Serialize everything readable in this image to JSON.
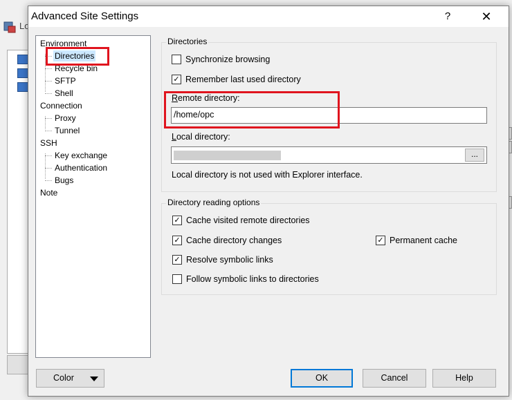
{
  "background_app": {
    "title_fragment": "Lo"
  },
  "dialog": {
    "title": "Advanced Site Settings",
    "help_glyph": "?",
    "close_glyph": "✕"
  },
  "tree": {
    "groups": [
      {
        "label": "Environment",
        "children": [
          "Directories",
          "Recycle bin",
          "SFTP",
          "Shell"
        ]
      },
      {
        "label": "Connection",
        "children": [
          "Proxy",
          "Tunnel"
        ]
      },
      {
        "label": "SSH",
        "children": [
          "Key exchange",
          "Authentication",
          "Bugs"
        ]
      },
      {
        "label": "Note",
        "children": []
      }
    ],
    "selected": "Directories"
  },
  "directories": {
    "group_title": "Directories",
    "sync_browsing": {
      "label": "Synchronize browsing",
      "checked": false
    },
    "remember_dir": {
      "label": "Remember last used directory",
      "checked": true
    },
    "remote_label_accel": "R",
    "remote_label_rest": "emote directory:",
    "remote_value": "/home/opc",
    "local_label_accel": "L",
    "local_label_rest": "ocal directory:",
    "browse_label": "...",
    "note": "Local directory is not used with Explorer interface."
  },
  "reading_options": {
    "group_title": "Directory reading options",
    "cache_remote": {
      "label": "Cache visited remote directories",
      "checked": true
    },
    "cache_changes": {
      "label": "Cache directory changes",
      "checked": true
    },
    "permanent_cache": {
      "label": "Permanent cache",
      "checked": true
    },
    "resolve_links": {
      "label": "Resolve symbolic links",
      "checked": true
    },
    "follow_links": {
      "label": "Follow symbolic links to directories",
      "checked": false
    }
  },
  "buttons": {
    "color": "Color",
    "ok": "OK",
    "cancel": "Cancel",
    "help": "Help"
  },
  "colors": {
    "highlight_red": "#e0141e",
    "selection": "#cce8ff",
    "default_button_border": "#0078d7"
  },
  "check_glyph": "✓"
}
